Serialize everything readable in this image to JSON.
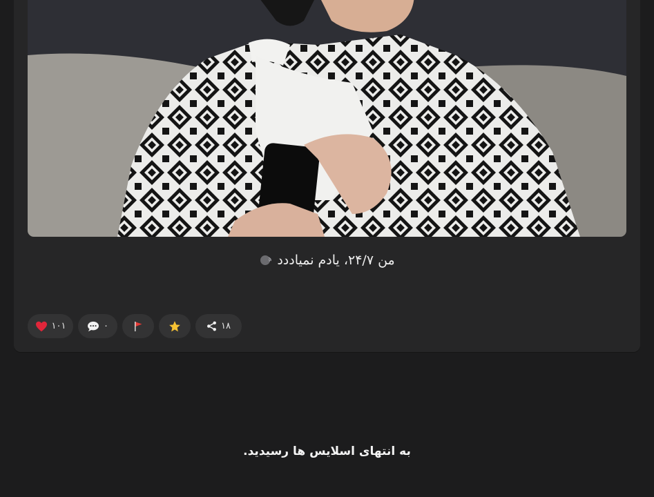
{
  "post": {
    "image_alt": "photo",
    "caption": "من ۲۴/۷، یادم نمیاددد",
    "caption_emoji_icon": "speaking-head-icon"
  },
  "actions": {
    "like_count": "۱۰۱",
    "like_icon": "heart-icon",
    "comment_count": "۰",
    "comment_icon": "speech-bubble-icon",
    "flag_icon": "flag-icon",
    "star_icon": "star-icon",
    "share_count": "۱۸",
    "share_icon": "share-icon"
  },
  "footer": {
    "end_message": "به انتهای اسلایس ها رسیدید."
  },
  "colors": {
    "background": "#1c1c1d",
    "card": "#262627",
    "pill": "#333334",
    "heart": "#e0263a",
    "star": "#f6c233",
    "flag": "#e53935"
  }
}
